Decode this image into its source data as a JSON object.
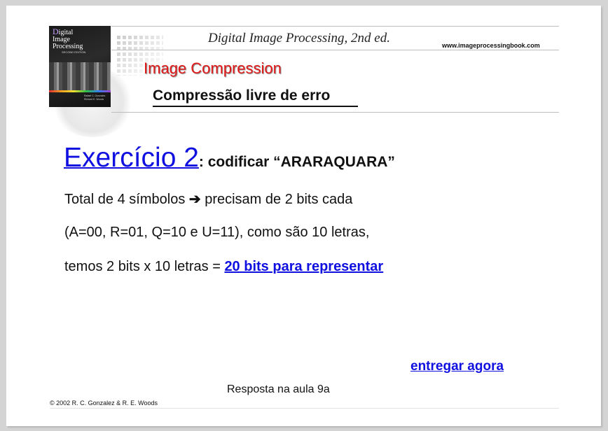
{
  "header": {
    "book_title": "Digital Image Processing, 2nd ed.",
    "url": "www.imageprocessingbook.com",
    "topic": "Image Compression",
    "subtopic": "Compressão livre de erro",
    "cover": {
      "title_line1": "igital",
      "title_line1_initial": "D",
      "title_line2": "Image",
      "title_line3": "Processing",
      "edition": "SECOND EDITION",
      "author1": "Rafael C. Gonzalez",
      "author2": "Richard E. Woods"
    }
  },
  "exercise": {
    "title": "Exercício 2",
    "description": ": codificar “ARARAQUARA”"
  },
  "body": {
    "line1_start": "Total de 4 símbolos ",
    "line1_arrow": "➔",
    "line1_end": " precisam de 2 bits cada",
    "line2": "(A=00, R=01, Q=10 e U=11), como são 10 letras,",
    "line3_start": "temos 2 bits x 10 letras  = ",
    "line3_link": "20 bits para representar"
  },
  "footer": {
    "submit_link": "entregar agora",
    "answer_note": "Resposta na aula 9a",
    "copyright": "© 2002 R. C. Gonzalez & R. E. Woods"
  },
  "colors": {
    "link": "#1010e0",
    "topic": "#e01818",
    "background": "#d4d4d4"
  }
}
